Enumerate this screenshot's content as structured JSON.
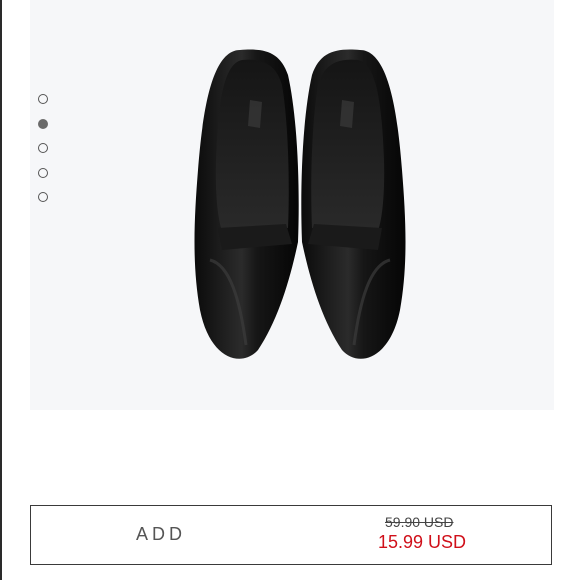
{
  "gallery": {
    "dot_count": 5,
    "active_index": 1,
    "image_icon": "black-pointed-pump-shoes"
  },
  "buy_bar": {
    "add_label": "ADD",
    "old_price": "59.90 USD",
    "new_price": "15.99 USD"
  },
  "colors": {
    "sale": "#d0101a",
    "viewer_bg": "#f6f7f9"
  }
}
